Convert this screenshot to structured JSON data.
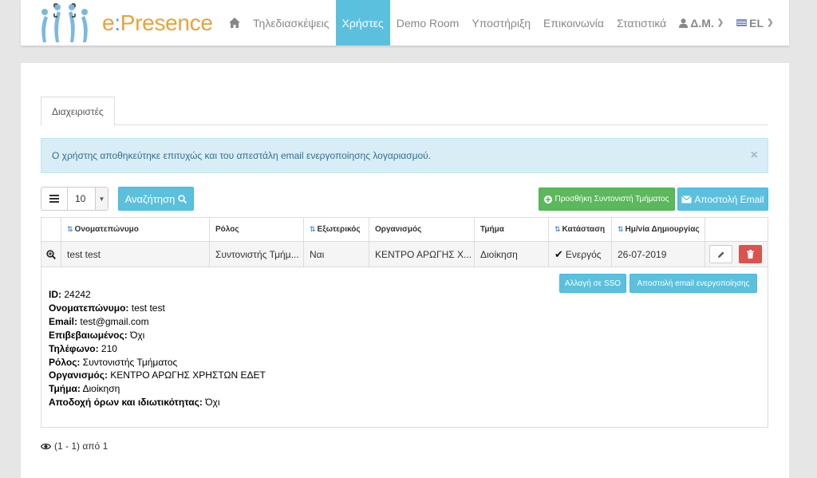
{
  "brand": {
    "prefix": "e",
    "separator": ":",
    "name": "Presence"
  },
  "nav": {
    "items": [
      {
        "label": "Τηλεδιασκέψεις"
      },
      {
        "label": "Χρήστες"
      },
      {
        "label": "Demo Room"
      },
      {
        "label": "Υποστήριξη"
      },
      {
        "label": "Επικοινωνία"
      },
      {
        "label": "Στατιστικά"
      }
    ],
    "user": "Δ.Μ.",
    "language": "EL",
    "active_item": "Χρήστες"
  },
  "tabs": [
    {
      "label": "Διαχειριστές"
    }
  ],
  "alert": {
    "message": "Ο χρήστης αποθηκεύτηκε επιτυχώς και του απεστάλη email ενεργοποίησης λογαριασμού.",
    "close": "×"
  },
  "toolbar": {
    "page_size": "10",
    "search_label": "Αναζήτηση",
    "add_coordinator_label": "Προσθήκη Συντονιστή Τμήματος",
    "send_email_label": "Αποστολή Email"
  },
  "table": {
    "headers": [
      "Ονοματεπώνυμο",
      "Ρόλος",
      "Εξωτερικός",
      "Οργανισμός",
      "Τμήμα",
      "Κατάσταση",
      "Ημ/νία Δημιουργίας"
    ],
    "row": {
      "name": "test test",
      "role": "Συντονιστής Τμήμ...",
      "external": "Ναι",
      "organization": "ΚΕΝΤΡΟ ΑΡΩΓΗΣ Χ...",
      "department": "Διοίκηση",
      "status": "Ενεργός",
      "created": "26-07-2019"
    }
  },
  "details": {
    "sso_button": "Αλλαγή σε SSO",
    "activation_button": "Αποστολή email ενεργοποίησης",
    "fields": [
      {
        "label": "ID:",
        "value": "24242"
      },
      {
        "label": "Ονοματεπώνυμο:",
        "value": "test test"
      },
      {
        "label": "Email:",
        "value": "test@gmail.com"
      },
      {
        "label": "Επιβεβαιωμένος:",
        "value": "Όχι"
      },
      {
        "label": "Τηλέφωνο:",
        "value": "210"
      },
      {
        "label": "Ρόλος:",
        "value": "Συντονιστής Τμήματος"
      },
      {
        "label": "Οργανισμός:",
        "value": "ΚΕΝΤΡΟ ΑΡΩΓΗΣ ΧΡΗΣΤΩΝ ΕΔΕΤ"
      },
      {
        "label": "Τμήμα:",
        "value": "Διοίκηση"
      },
      {
        "label": "Αποδοχή όρων και ιδιωτικότητας:",
        "value": "Όχι"
      }
    ]
  },
  "pager": {
    "text": "(1 - 1) από 1"
  },
  "colors": {
    "info": "#5bc0de",
    "success": "#5cb85c",
    "danger": "#d9534f",
    "brand_orange": "#e8a33a",
    "brand_blue": "#7ab8e3"
  },
  "icons": [
    "home-icon",
    "user-icon",
    "flag-icon",
    "chevron-down-icon",
    "list-icon",
    "search-icon",
    "plus-circle-icon",
    "envelope-icon",
    "sort-icon",
    "zoom-in-icon",
    "check-icon",
    "pencil-icon",
    "trash-icon",
    "eye-icon",
    "close-icon"
  ]
}
